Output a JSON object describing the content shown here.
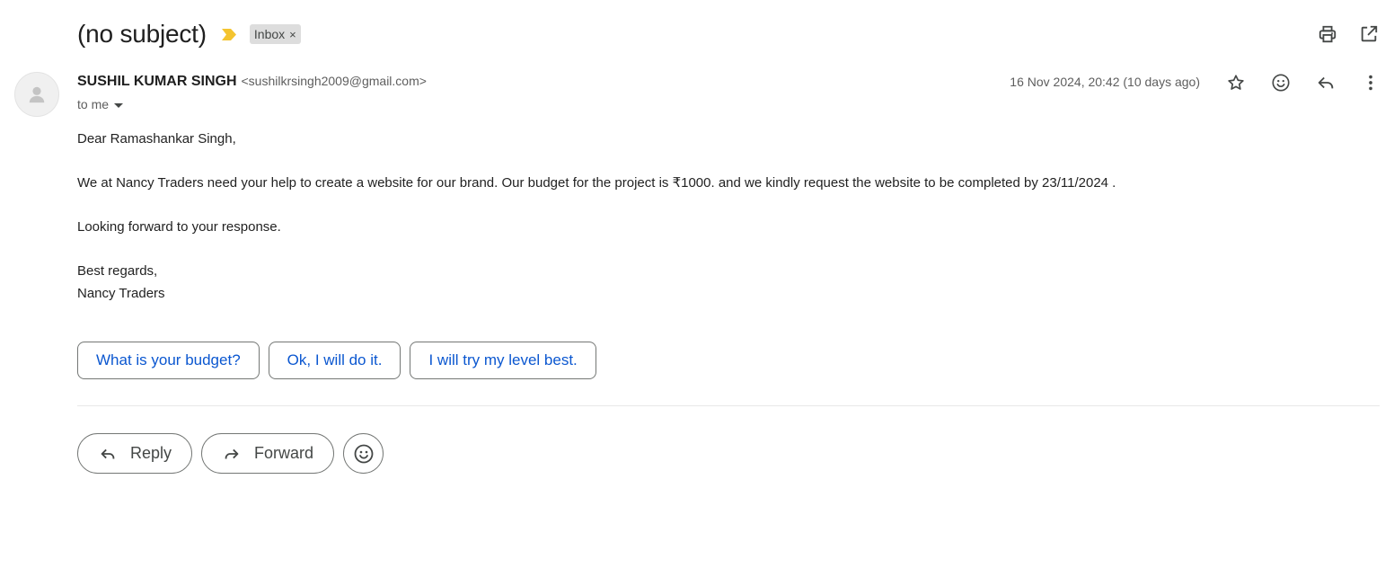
{
  "email": {
    "subject": "(no subject)",
    "label": "Inbox",
    "label_remove": "×",
    "sender": {
      "name": "SUSHIL KUMAR SINGH",
      "email": "<sushilkrsingh2009@gmail.com>"
    },
    "recipient": "to me",
    "date": "16 Nov 2024, 20:42 (10 days ago)",
    "body": {
      "greeting": "Dear Ramashankar Singh,",
      "paragraph": "We at Nancy Traders need your help to create a website for our brand. Our budget for the project is ₹1000. and we kindly request the website to be completed by 23/11/2024 .",
      "closing_line": "Looking forward to your response.",
      "sign_off": "Best regards,",
      "signature": "Nancy Traders"
    }
  },
  "smart_replies": [
    "What is your budget?",
    "Ok, I will do it.",
    "I will try my level best."
  ],
  "actions": {
    "reply_label": "Reply",
    "forward_label": "Forward"
  },
  "icons": {
    "importance": "importance-marker-icon",
    "print": "print-icon",
    "open_new_window": "open-in-new-window-icon",
    "star": "star-icon",
    "emoji": "emoji-icon",
    "reply": "reply-icon",
    "more": "more-vert-icon",
    "forward": "forward-icon",
    "avatar": "person-icon"
  },
  "colors": {
    "importance": "#f4c430",
    "link": "#0b57d0",
    "label_bg": "#dddddd"
  }
}
